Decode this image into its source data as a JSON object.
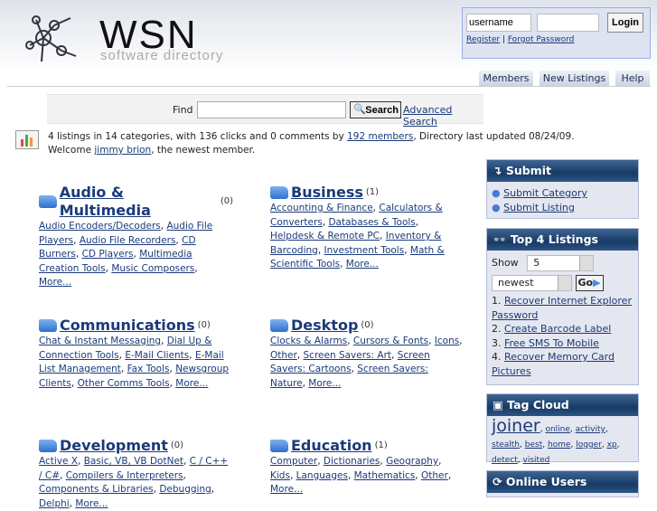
{
  "header": {
    "logo_text": "WSN",
    "tagline": "software directory"
  },
  "login": {
    "username_value": "username",
    "password_value": "",
    "login_label": "Login",
    "register": "Register",
    "forgot": "Forgot Password"
  },
  "nav": [
    "Members",
    "New Listings",
    "Help"
  ],
  "search": {
    "label": "Find",
    "value": "",
    "button": "Search",
    "advanced": "Advanced Search"
  },
  "stats": {
    "text1": "4 listings in 14 categories, with 136 clicks and 0 comments by ",
    "members_link": "192 members",
    "text2": ", Directory last updated 08/24/09.",
    "welcome": "Welcome ",
    "newest_link": "jimmy brion",
    "welcome_end": ", the newest member."
  },
  "categories": [
    {
      "name": "Audio & Multimedia",
      "count": "(0)",
      "subs": [
        "Audio Encoders/Decoders",
        "Audio File Players",
        "Audio File Recorders",
        "CD Burners",
        "CD Players",
        "Multimedia Creation Tools",
        "Music Composers",
        "More..."
      ]
    },
    {
      "name": "Business",
      "count": "(1)",
      "subs": [
        "Accounting & Finance",
        "Calculators & Converters",
        "Databases & Tools",
        "Helpdesk & Remote PC",
        "Inventory & Barcoding",
        "Investment Tools",
        "Math & Scientific Tools",
        "More..."
      ]
    },
    {
      "name": "Communications",
      "count": "(0)",
      "subs": [
        "Chat & Instant Messaging",
        "Dial Up & Connection Tools",
        "E-Mail Clients",
        "E-Mail List Management",
        "Fax Tools",
        "Newsgroup Clients",
        "Other Comms Tools",
        "More..."
      ]
    },
    {
      "name": "Desktop",
      "count": "(0)",
      "subs": [
        "Clocks & Alarms",
        "Cursors & Fonts",
        "Icons",
        "Other",
        "Screen Savers: Art",
        "Screen Savers: Cartoons",
        "Screen Savers: Nature",
        "More..."
      ]
    },
    {
      "name": "Development",
      "count": "(0)",
      "subs": [
        "Active X",
        "Basic, VB, VB DotNet",
        "C / C++ / C#",
        "Compilers & Interpreters",
        "Components & Libraries",
        "Debugging",
        "Delphi",
        "More..."
      ]
    },
    {
      "name": "Education",
      "count": "(1)",
      "subs": [
        "Computer",
        "Dictionaries",
        "Geography",
        "Kids",
        "Languages",
        "Mathematics",
        "Other",
        "More..."
      ]
    }
  ],
  "sidebar": {
    "submit": {
      "title": "Submit",
      "links": [
        "Submit Category",
        "Submit Listing"
      ]
    },
    "top": {
      "title": "Top 4 Listings",
      "show_label": "Show",
      "show_value": "5",
      "sort_value": "newest",
      "go": "Go",
      "items": [
        "Recover Internet Explorer Password",
        "Create Barcode Label",
        "Free SMS To Mobile",
        "Recover Memory Card Pictures"
      ]
    },
    "tags": {
      "title": "Tag Cloud",
      "items": [
        "joiner",
        "online",
        "activity",
        "stealth",
        "best",
        "home",
        "logger",
        "xp",
        "detect",
        "visited"
      ]
    },
    "online": {
      "title": "Online Users"
    }
  }
}
